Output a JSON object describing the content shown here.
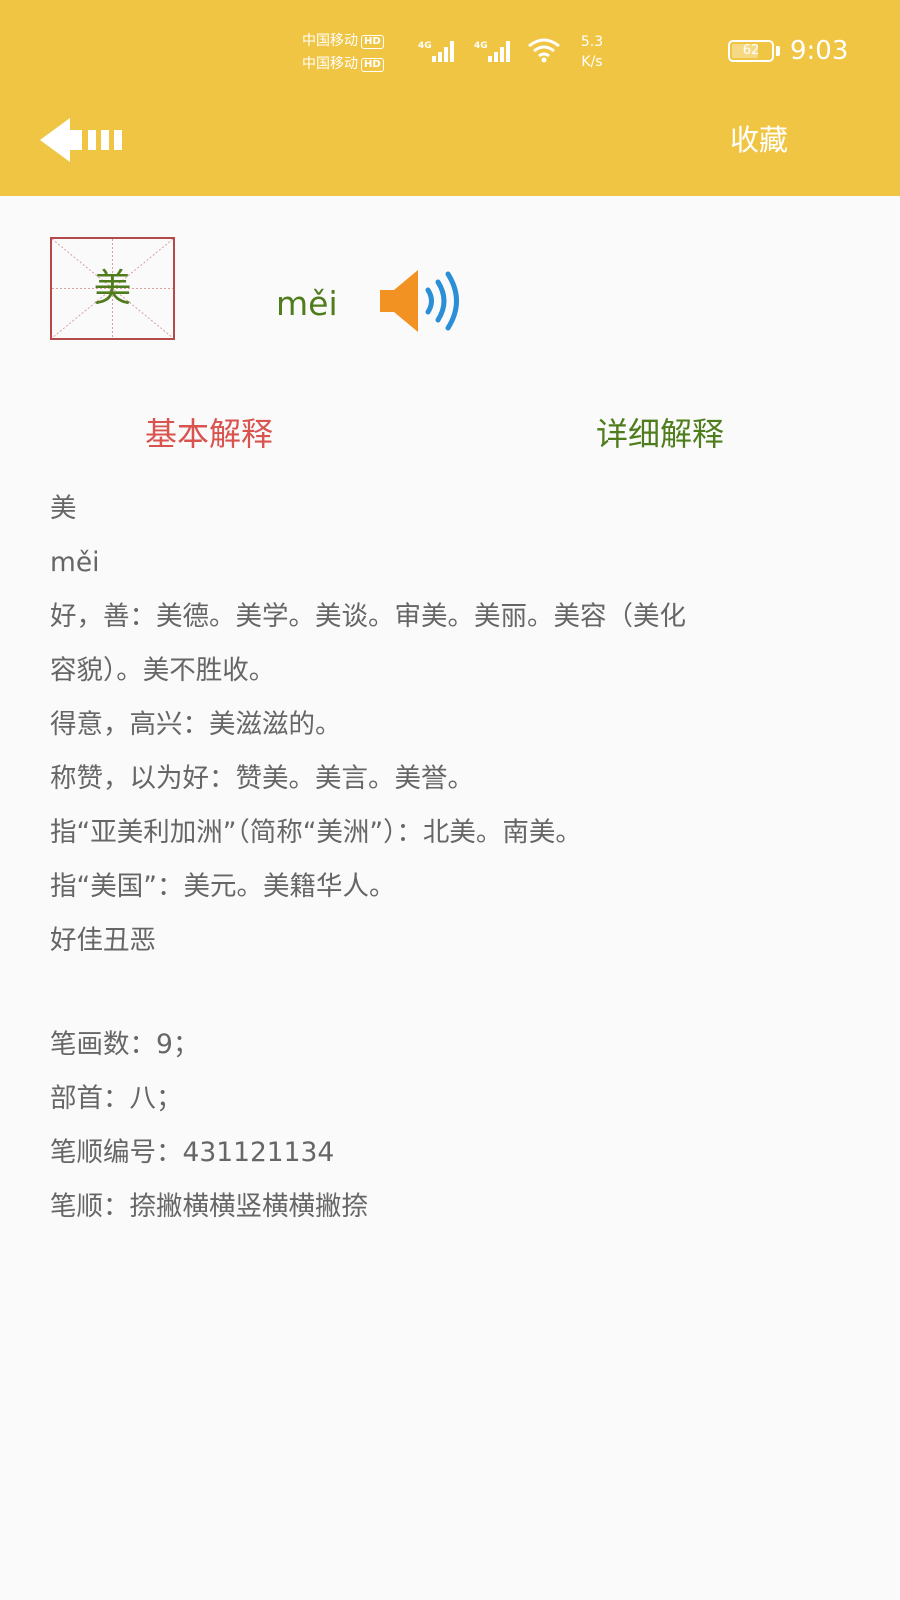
{
  "status_bar": {
    "carrier_1": "中国移动",
    "carrier_2": "中国移动",
    "hd_badge": "HD",
    "network_1": "4G",
    "network_2": "4G",
    "speed_value": "5.3",
    "speed_unit": "K/s",
    "battery": "62",
    "battery_level": 0.62,
    "time": "9:03"
  },
  "header": {
    "favorite_label": "收藏"
  },
  "character": {
    "glyph": "美",
    "pinyin": "měi"
  },
  "tabs": {
    "basic": "基本解释",
    "detailed": "详细解释",
    "active": "basic"
  },
  "colors": {
    "header_bg": "#f0c544",
    "active_tab": "#d9534f",
    "inactive_tab": "#4f7d1e",
    "character_text": "#4f7d1e",
    "body_text": "#666666",
    "grid_border": "#b54a4a"
  },
  "definition": {
    "char": "美",
    "pinyin": "měi",
    "meaning_1a": "好，善：美德。美学。美谈。审美。美丽。美容（美化",
    "meaning_1b": "容貌）。美不胜收。",
    "meaning_2": "得意，高兴：美滋滋的。",
    "meaning_3": "称赞，以为好：赞美。美言。美誉。",
    "meaning_4": "指“亚美利加洲”（简称“美洲”）：北美。南美。",
    "meaning_5": "指“美国”：美元。美籍华人。",
    "antonyms": "好佳丑恶"
  },
  "info": {
    "stroke_count": "笔画数：9；",
    "radical": "部首：八；",
    "stroke_code": "笔顺编号：431121134",
    "stroke_order": "笔顺：捺撇横横竖横横撇捺"
  },
  "icons": {
    "back": "back-arrow-icon",
    "speaker": "speaker-icon",
    "wifi": "wifi-icon",
    "signal": "signal-icon"
  }
}
